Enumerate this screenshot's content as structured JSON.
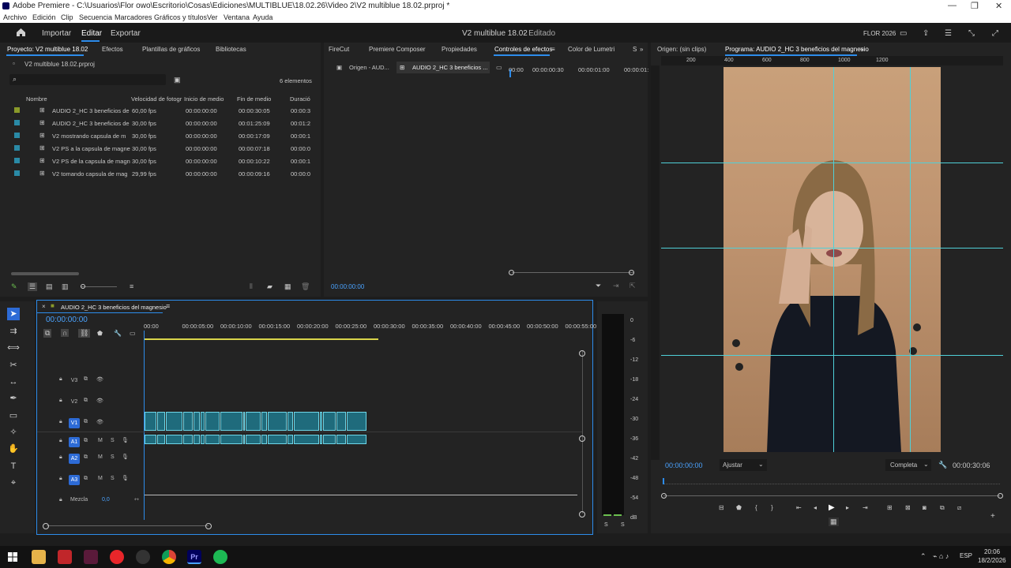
{
  "titlebar": {
    "title": "Adobe Premiere - C:\\Usuarios\\Flor owo\\Escritorio\\Cosas\\Ediciones\\MULTIBLUE\\18.02.26\\Video 2\\V2 multiblue 18.02.prproj *"
  },
  "menu": [
    "Archivo",
    "Edición",
    "Clip",
    "Secuencia",
    "Marcadores",
    "Gráficos y títulos",
    "Ver",
    "Ventana",
    "Ayuda"
  ],
  "appbar": {
    "importar": "Importar",
    "editar": "Editar",
    "exportar": "Exportar",
    "project_title": "V2 multiblue 18.02",
    "status": "- Editado",
    "workspace": "FLOR 2026"
  },
  "project": {
    "tabs": [
      "Proyecto: V2 multiblue 18.02",
      "Efectos",
      "Plantillas de gráficos",
      "Bibliotecas"
    ],
    "file": "V2 multiblue 18.02.prproj",
    "count": "6 elementos",
    "headers": [
      "Nombre",
      "Velocidad de fotogr",
      "Inicio de medio",
      "Fin de medio",
      "Duració"
    ],
    "rows": [
      {
        "name": "AUDIO 2_HC 3 beneficios de",
        "fps": "60,00 fps",
        "start": "00:00:00:00",
        "end": "00:00:30:05",
        "dur": "00:00:3",
        "color": "#8a9a2a"
      },
      {
        "name": "AUDIO 2_HC 3 beneficios de",
        "fps": "30,00 fps",
        "start": "00:00:00:00",
        "end": "00:01:25:09",
        "dur": "00:01:2",
        "color": "#2a8aa6"
      },
      {
        "name": "V2 mostrando capsula de m",
        "fps": "30,00 fps",
        "start": "00:00:00:00",
        "end": "00:00:17:09",
        "dur": "00:00:1",
        "color": "#2a8aa6"
      },
      {
        "name": "V2 PS a la capsula de magne",
        "fps": "30,00 fps",
        "start": "00:00:00:00",
        "end": "00:00:07:18",
        "dur": "00:00:0",
        "color": "#2a8aa6"
      },
      {
        "name": "V2 PS de la capsula de magn",
        "fps": "30,00 fps",
        "start": "00:00:00:00",
        "end": "00:00:10:22",
        "dur": "00:00:1",
        "color": "#2a8aa6"
      },
      {
        "name": "V2 tomando capsula de mag",
        "fps": "29,99 fps",
        "start": "00:00:00:00",
        "end": "00:00:09:16",
        "dur": "00:00:0",
        "color": "#2a8aa6"
      }
    ]
  },
  "effects": {
    "tabs": [
      "FireCut",
      "Premiere Composer",
      "Propiedades",
      "Controles de efectos",
      "Color de Lumetri",
      "S"
    ],
    "source_tab": "Origen - AUD...",
    "clip_tab": "AUDIO 2_HC 3 beneficios ...",
    "ruler": [
      "00:00",
      "00:00:00:30",
      "00:00:01:00",
      "00:00:01:"
    ],
    "timecode": "00:00:00:00"
  },
  "program": {
    "source_tab": "Origen: (sin clips)",
    "program_tab": "Programa: AUDIO 2_HC 3 beneficios del magnesio",
    "ruler": [
      "200",
      "400",
      "600",
      "800",
      "1000",
      "1200"
    ],
    "timecode": "00:00:00:00",
    "fit": "Ajustar",
    "quality": "Completa",
    "duration": "00:00:30:06"
  },
  "timeline": {
    "tab": "AUDIO 2_HC 3 beneficios del magnesio",
    "timecode": "00:00:00:00",
    "ruler": [
      "00:00",
      "00:00:05:00",
      "00:00:10:00",
      "00:00:15:00",
      "00:00:20:00",
      "00:00:25:00",
      "00:00:30:00",
      "00:00:35:00",
      "00:00:40:00",
      "00:00:45:00",
      "00:00:50:00",
      "00:00:55:00"
    ],
    "tracks": {
      "v3": "V3",
      "v2": "V2",
      "v1": "V1",
      "a1": "A1",
      "a2": "A2",
      "a3": "A3",
      "mix": "Mezcla",
      "mix_val": "0,0",
      "m": "M",
      "s": "S"
    }
  },
  "meter": {
    "scale": [
      "0",
      "-6",
      "-12",
      "-18",
      "-24",
      "-30",
      "-36",
      "-42",
      "-48",
      "-54",
      "dB"
    ],
    "s": "S"
  },
  "taskbar": {
    "lang": "ESP",
    "time": "20:06",
    "date": "18/2/2026"
  }
}
